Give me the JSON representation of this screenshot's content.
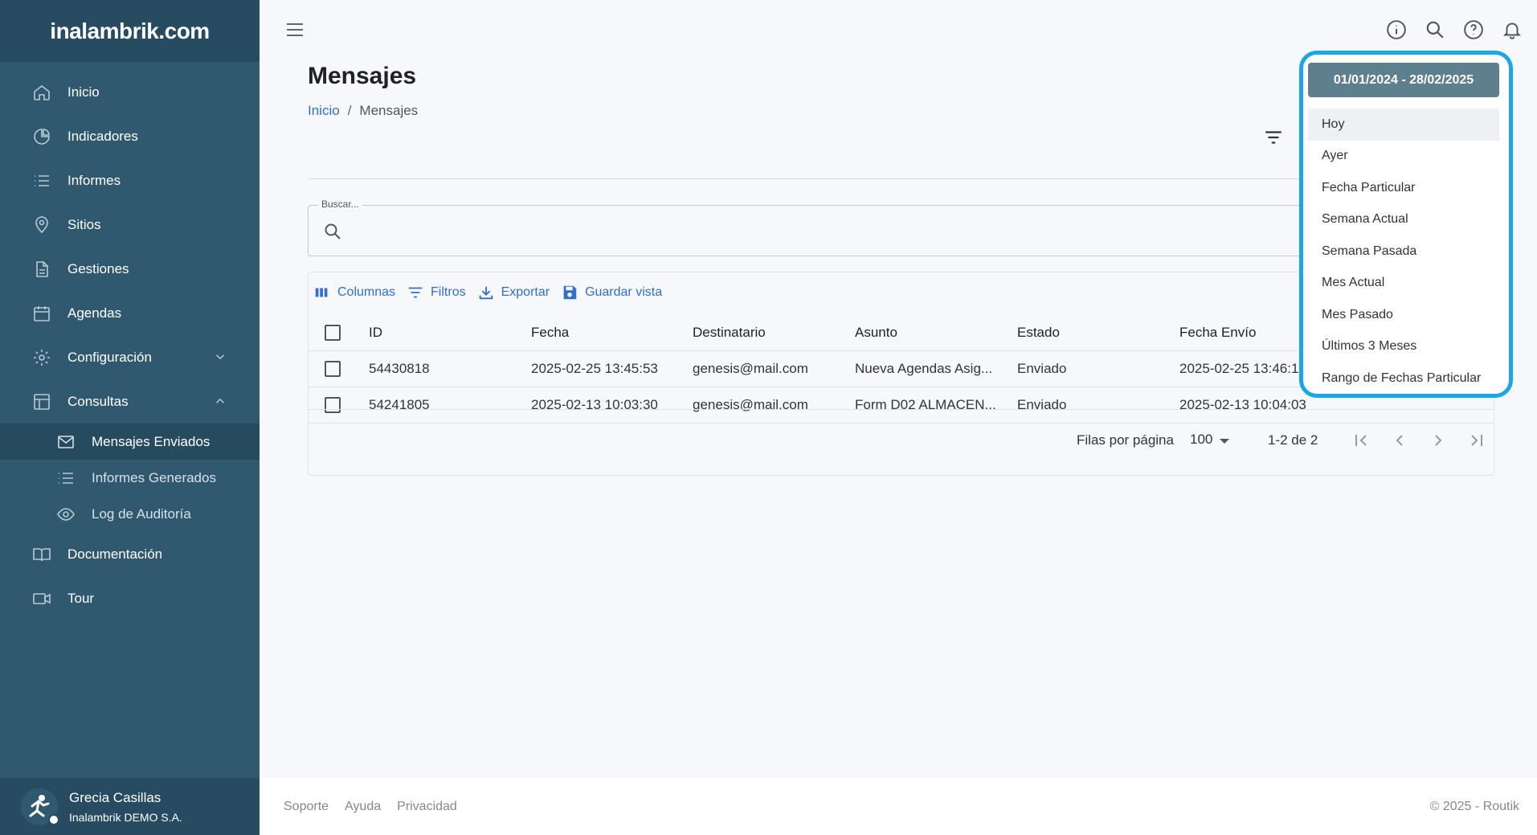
{
  "app": {
    "logo_text": "inalambrik.com"
  },
  "sidebar": {
    "items": [
      {
        "label": "Inicio",
        "icon": "home-icon"
      },
      {
        "label": "Indicadores",
        "icon": "pie-chart-icon"
      },
      {
        "label": "Informes",
        "icon": "list-icon"
      },
      {
        "label": "Sitios",
        "icon": "location-pin-icon"
      },
      {
        "label": "Gestiones",
        "icon": "document-icon"
      },
      {
        "label": "Agendas",
        "icon": "calendar-icon"
      },
      {
        "label": "Configuración",
        "icon": "gear-icon"
      },
      {
        "label": "Consultas",
        "icon": "table-icon"
      }
    ],
    "sub_items": [
      {
        "label": "Mensajes Enviados",
        "icon": "mail-icon",
        "active": true
      },
      {
        "label": "Informes Generados",
        "icon": "list-icon"
      },
      {
        "label": "Log de Auditoría",
        "icon": "eye-icon"
      }
    ],
    "bottom_items": [
      {
        "label": "Documentación",
        "icon": "book-icon"
      },
      {
        "label": "Tour",
        "icon": "video-icon"
      }
    ],
    "user": {
      "name": "Grecia Casillas",
      "org": "Inalambrik DEMO S.A."
    }
  },
  "header": {
    "title": "Mensajes",
    "breadcrumb_home": "Inicio",
    "breadcrumb_sep": "/",
    "breadcrumb_current": "Mensajes"
  },
  "search": {
    "label": "Buscar..."
  },
  "toolbar": {
    "columns": "Columnas",
    "filters": "Filtros",
    "export": "Exportar",
    "save_view": "Guardar vista"
  },
  "table": {
    "headers": [
      "ID",
      "Fecha",
      "Destinatario",
      "Asunto",
      "Estado",
      "Fecha Envío"
    ],
    "rows": [
      [
        "54430818",
        "2025-02-25 13:45:53",
        "genesis@mail.com",
        "Nueva Agendas Asig...",
        "Enviado",
        "2025-02-25 13:46:1"
      ],
      [
        "54241805",
        "2025-02-13 10:03:30",
        "genesis@mail.com",
        "Form D02 ALMACEN...",
        "Enviado",
        "2025-02-13 10:04:03"
      ]
    ]
  },
  "pager": {
    "rows_label": "Filas por página",
    "rows_value": "100",
    "range": "1-2 de 2"
  },
  "date_dropdown": {
    "selected": "01/01/2024 - 28/02/2025",
    "options": [
      "Hoy",
      "Ayer",
      "Fecha Particular",
      "Semana Actual",
      "Semana Pasada",
      "Mes Actual",
      "Mes Pasado",
      "Últimos 3 Meses",
      "Rango de Fechas Particular"
    ]
  },
  "footer": {
    "links": [
      "Soporte",
      "Ayuda",
      "Privacidad"
    ],
    "copyright": "© 2025 - Routik"
  },
  "colors": {
    "sidebar": "#30596f",
    "sidebar_dark": "#274c61",
    "accent": "#2f6fd1",
    "highlight": "#1aa7e8"
  }
}
